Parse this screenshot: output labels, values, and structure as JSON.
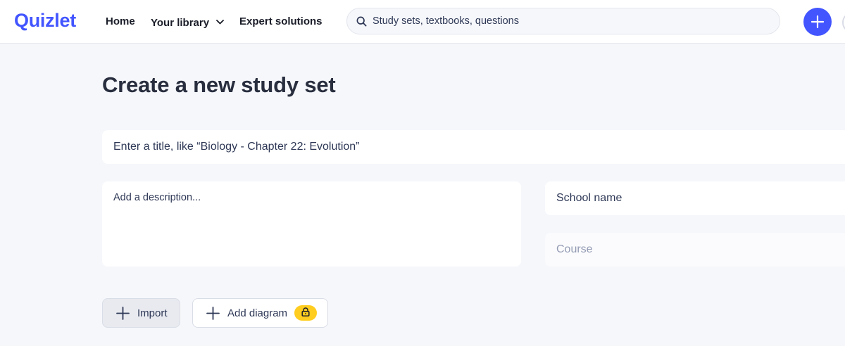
{
  "header": {
    "logo": "Quizlet",
    "nav": {
      "home": "Home",
      "library": "Your library",
      "expert": "Expert solutions"
    },
    "search": {
      "placeholder": "Study sets, textbooks, questions",
      "icon": "search-icon"
    },
    "create_icon": "plus-icon"
  },
  "main": {
    "title": "Create a new study set",
    "title_input": {
      "placeholder": "Enter a title, like “Biology - Chapter 22: Evolution”",
      "value": ""
    },
    "description_input": {
      "placeholder": "Add a description...",
      "value": ""
    },
    "school_input": {
      "placeholder": "School name",
      "value": ""
    },
    "course_input": {
      "placeholder": "Course",
      "value": ""
    },
    "actions": {
      "import_label": "Import",
      "add_diagram_label": "Add diagram",
      "lock_icon": "lock-icon"
    }
  },
  "colors": {
    "brand": "#4255ff",
    "badge": "#ffcd1f",
    "background": "#f6f7fb"
  }
}
